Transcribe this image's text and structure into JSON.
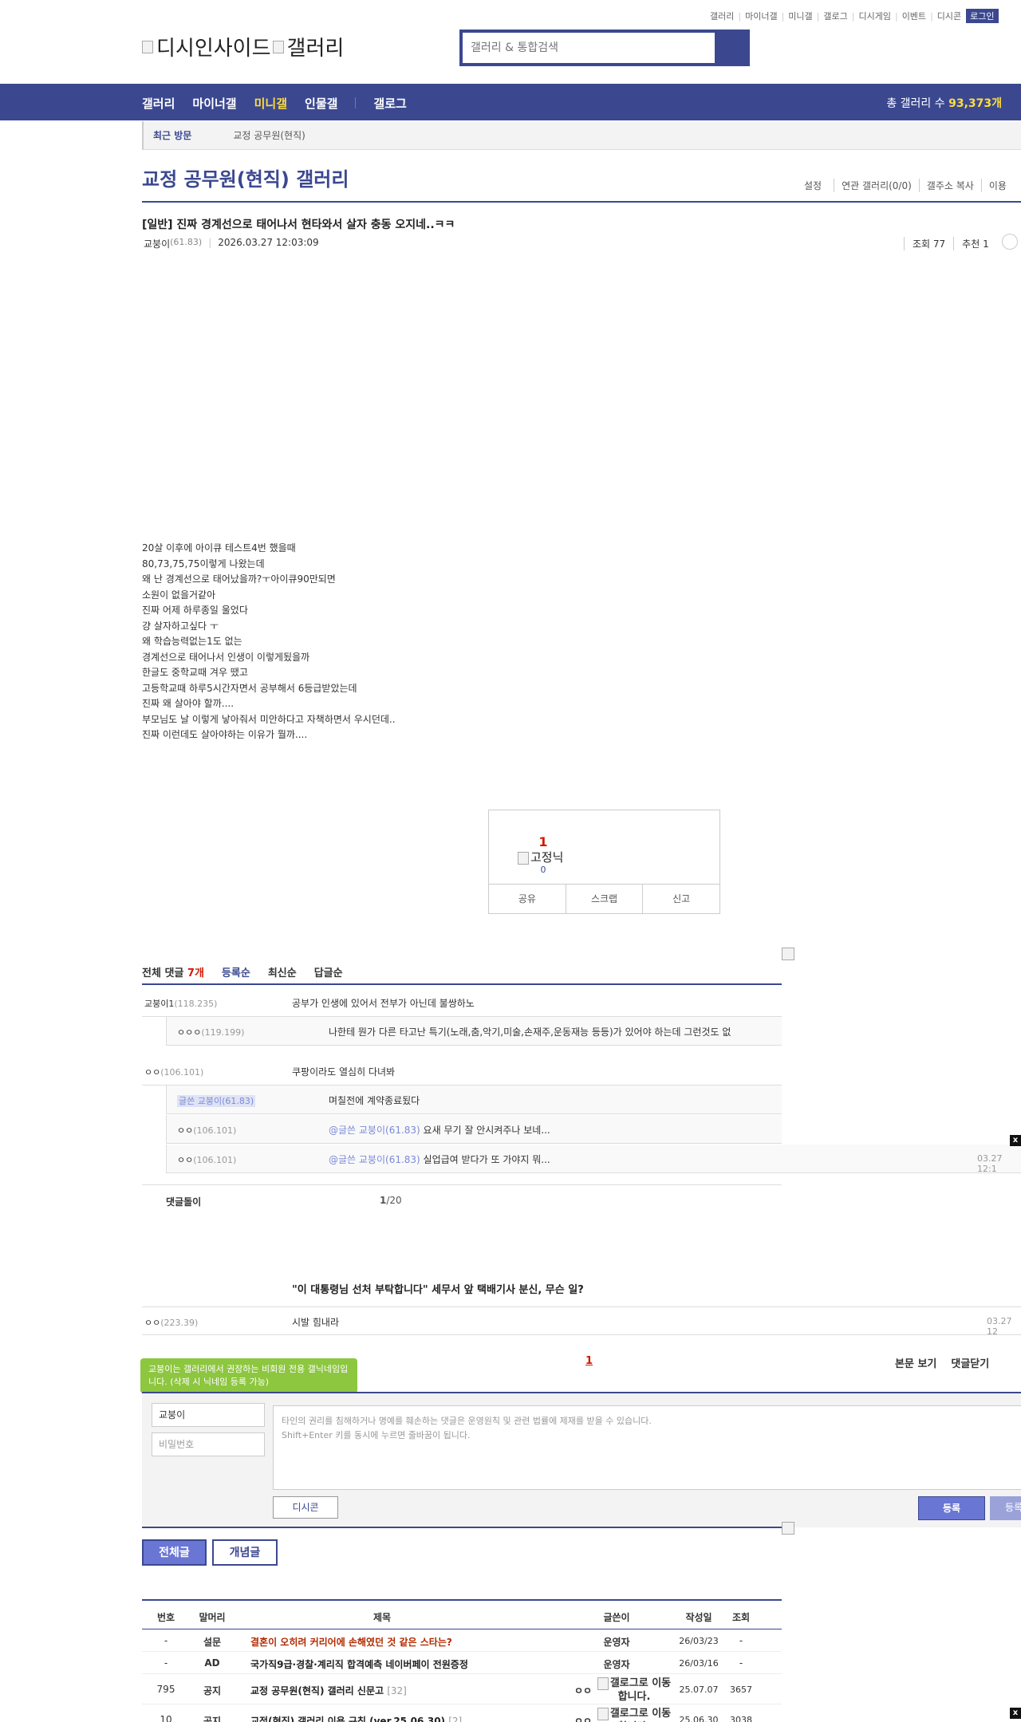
{
  "util_links": [
    "갤러리",
    "마이너갤",
    "미니갤",
    "갤로그",
    "디시게임",
    "이벤트",
    "디시콘"
  ],
  "login_label": "로그인",
  "logo": {
    "site_alt": "디시인사이드",
    "gallery_alt": "갤러리"
  },
  "search": {
    "placeholder": "갤러리 & 통합검색"
  },
  "gnb": {
    "items": [
      "갤러리",
      "마이너갤",
      "미니갤",
      "인물갤"
    ],
    "gallog": "갤로그",
    "count_label": "총 갤러리 수",
    "count_value": "93,373개"
  },
  "recent": {
    "label": "최근 방문",
    "item": "교정 공무원(현직)"
  },
  "gallery": {
    "title": "교정 공무원(현직) 갤러리",
    "menu": [
      "설정",
      "연관 갤러리(0/0)",
      "갤주소 복사",
      "이용"
    ]
  },
  "post": {
    "title": "[일반] 진짜 경계선으로 태어나서 현타와서 살자 충동 오지네..ㅋㅋ",
    "author": "교붕이",
    "author_ip": "(61.83)",
    "date": "2026.03.27 12:03:09",
    "views": "조회 77",
    "recommends": "추천 1",
    "body": [
      "20살 이후에 아이큐 테스트4번 했을때",
      "80,73,75,75이렇게 나왔는데",
      "왜 난 경계선으로 태어났을까?ㅜ아이큐90만되면",
      "소원이 없을거같아",
      "진짜 어제 하루종일 울었다",
      "걍 살자하고싶다 ㅜ",
      "왜 학습능력없는1도 없는",
      "경계선으로 태어나서 인생이 이렇게됬을까",
      "한글도 중학교때 겨우 땠고",
      "고등학교때 하루5시간자면서 공부해서 6등급받았는데",
      "진짜 왜 살아야 할까....",
      "부모님도 날 이렇게 낳아줘서 미안하다고 자책하면서 우시던데..",
      "진짜 이런데도 살아야하는 이유가 뭘까...."
    ]
  },
  "recommend_box": {
    "count": "1",
    "fixed_nick_alt": "고정닉",
    "fixed_count": "0",
    "buttons": [
      "공유",
      "스크랩",
      "신고"
    ]
  },
  "comments": {
    "label": "전체 댓글",
    "count": "7개",
    "sort_options": [
      "등록순",
      "최신순",
      "답글순"
    ],
    "rows": [
      {
        "nick": "교붕이1",
        "ip": "(118.235)",
        "text": "공부가 인생에 있어서 전부가 아닌데 불쌍하노"
      },
      {
        "nick": "ㅇㅇㅇ",
        "ip": "(119.199)",
        "text": "나한테 뭔가 다른 타고난 특기(노래,춤,악기,미술,손재주,운동재능 등등)가 있어야 하는데 그런것도 없"
      },
      {
        "nick": "ㅇㅇ",
        "ip": "(106.101)",
        "text": "쿠팡이라도 열심히 다녀봐"
      },
      {
        "writer_tag": "글쓴 교붕이",
        "ip": "(61.83)",
        "text": "며칠전에 계약종료됬다"
      },
      {
        "nick": "ㅇㅇ",
        "ip": "(106.101)",
        "mention": "@글쓴 교붕이(61.83)",
        "text": " 요새 무기 잘 안시켜주나 보네..."
      },
      {
        "nick": "ㅇㅇ",
        "ip": "(106.101)",
        "mention": "@글쓴 교붕이(61.83)",
        "text": " 실업급여 받다가 또 가야지 뭐...",
        "date": "03.27 12:1"
      }
    ],
    "dolbot_label": "댓글돌이",
    "dolbot_page": "1",
    "dolbot_total": "/20",
    "news_title": "\"이 대통령님 선처 부탁합니다\" 세무서 앞 택배기사 분신, 무슨 일?",
    "extra": {
      "nick": "ㅇㅇ",
      "ip": "(223.39)",
      "text": "시발 힘내라",
      "date": "03.27 12"
    }
  },
  "comment_pager": {
    "page": "1",
    "view_post": "본문 보기",
    "close_comments": "댓글닫기"
  },
  "tooltip": "교붕이는 갤러리에서 권장하는 비회원 전용 갤닉네임입니다. (삭제 시 닉네임 등록 가능)",
  "write": {
    "nick_value": "교붕이",
    "pw_placeholder": "비밀번호",
    "textarea_line1": "타인의 권리를 침해하거나 명예를 훼손하는 댓글은 운영원칙 및 관련 법률에 제재를 받을 수 있습니다.",
    "textarea_line2": "Shift+Enter 키를 동시에 누르면 줄바꿈이 됩니다.",
    "dccon": "디시콘",
    "submit": "등록",
    "submit2": "등록"
  },
  "tabs": {
    "all": "전체글",
    "concept": "개념글"
  },
  "list": {
    "headers": [
      "번호",
      "말머리",
      "제목",
      "글쓴이",
      "작성일",
      "조회"
    ],
    "rows": [
      {
        "num": "-",
        "head": "설문",
        "title": "결혼이 오히려 커리어에 손해였던 것 같은 스타는?",
        "writer": "운영자",
        "date": "26/03/23",
        "views": "-",
        "red": true
      },
      {
        "num": "-",
        "head": "AD",
        "title": "국가직9급·경찰·계리직 합격예측 네이버페이 전원증정",
        "writer": "운영자",
        "date": "26/03/16",
        "views": "-"
      },
      {
        "num": "795",
        "head": "공지",
        "title": "교정 공무원(현직) 갤러리 신문고",
        "cc": "[32]",
        "writer_nick": "ㅇㅇ",
        "writer_alt": "갤로그로 이동합니다.",
        "date": "25.07.07",
        "views": "3657"
      },
      {
        "num": "10",
        "head": "공지",
        "title": "교정(현직) 갤러리 이용 규칙 (ver.25.06.30)",
        "cc": "[2]",
        "writer_nick": "ㅇㅇ",
        "writer_alt": "갤로그로 이동합니다.",
        "date": "25.06.30",
        "views": "3038"
      }
    ]
  },
  "close_x": "x"
}
